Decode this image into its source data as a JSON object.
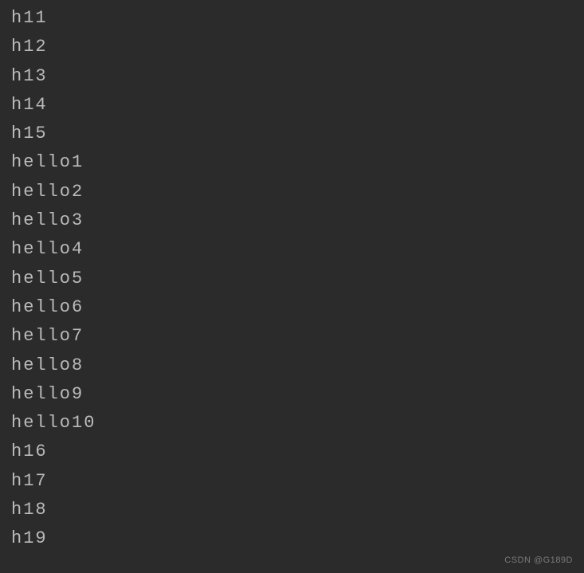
{
  "output": {
    "lines": [
      "h11",
      "h12",
      "h13",
      "h14",
      "h15",
      "hello1",
      "hello2",
      "hello3",
      "hello4",
      "hello5",
      "hello6",
      "hello7",
      "hello8",
      "hello9",
      "hello10",
      "h16",
      "h17",
      "h18",
      "h19"
    ]
  },
  "watermark": "CSDN @G189D"
}
